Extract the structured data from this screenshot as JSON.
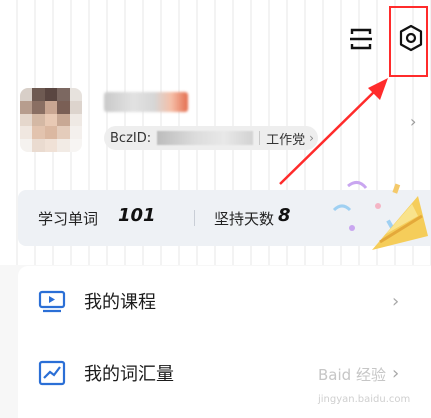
{
  "header": {
    "scan_icon": "scan-icon",
    "settings_icon": "gear-icon",
    "highlight_color": "#ff2b2b"
  },
  "profile": {
    "id_label": "BczID:",
    "party_label": "工作党",
    "id_chevron": "›",
    "profile_chevron": "›"
  },
  "stats": {
    "words_label": "学习单词",
    "words_value": "101",
    "days_label": "坚持天数",
    "days_value": "8"
  },
  "menu": {
    "items": [
      {
        "label": "我的课程",
        "icon": "video-course-icon",
        "chevron": "›"
      },
      {
        "label": "我的词汇量",
        "icon": "trend-chart-icon",
        "chevron": "›"
      }
    ]
  },
  "watermark": {
    "text": "Baid  经验",
    "sub": "jingyan.baidu.com"
  },
  "colors": {
    "accent_blue": "#2b6fd6",
    "annotation_red": "#ff2b2b"
  }
}
